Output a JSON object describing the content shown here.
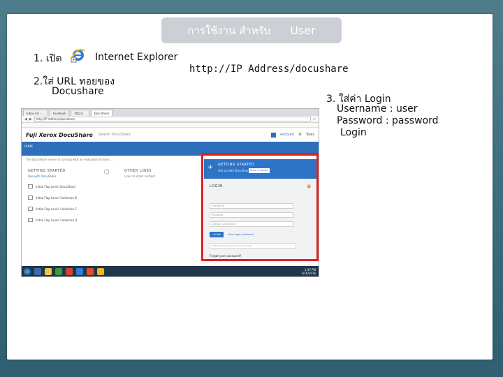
{
  "slide": {
    "title_left": "การใช้งาน สำหรับ",
    "title_right": "User",
    "step1_number": "1. เปิด",
    "step1_app": "Internet Explorer",
    "step2_line1": "2.ใส่  URL ทอยของ",
    "step2_line2": "Docushare",
    "url": "http://IP Address/docushare",
    "step3_title": "3.  ใส่ค่า    Login",
    "username_line": "Username : user",
    "password_line": "Password  : password",
    "login_line": "Login"
  },
  "screenshot": {
    "tabs": [
      "Inbox (1) - ...",
      "Facebook",
      "http://...",
      "DocuShare"
    ],
    "logo": "Fuji Xerox DocuShare",
    "search_label": "Search DocuShare",
    "header_links": [
      "Account",
      "Tools"
    ],
    "nav_home": "HOME",
    "notice": "The DocuShare server is running with an evaluation license ...",
    "col1_title": "GETTING STARTED",
    "col1_sub": "Use with DocuShare",
    "col2_title": "OTHER LINKS",
    "col2_sub": "Links to other content",
    "quick_items": [
      "Initial Flop Level: DocuShare",
      "Initial Flop Level: Collection B",
      "Initial Flop Level: Collection C",
      "Initial Flop Level: Collection D"
    ],
    "getting_started_title": "GETTING STARTED",
    "getting_started_text": "Get on with DocuShare",
    "getting_started_button": "Learn it quickly",
    "login_title": "LOGIN",
    "username_placeholder": "Username",
    "password_placeholder": "Password",
    "domain_value": "Domain: DocuShare",
    "login_button": "LOGIN",
    "forgot_link": "Have login problems?",
    "remember_note": "Remember my login on this computer",
    "help_text": "Forgot your password?",
    "clock_time": "1:37 PM",
    "clock_date": "2/16/2016"
  },
  "colors": {
    "background": "#3f6d7d",
    "title_box": "#ccd0d6",
    "accent_blue": "#2e74c6",
    "highlight": "#e02020"
  }
}
